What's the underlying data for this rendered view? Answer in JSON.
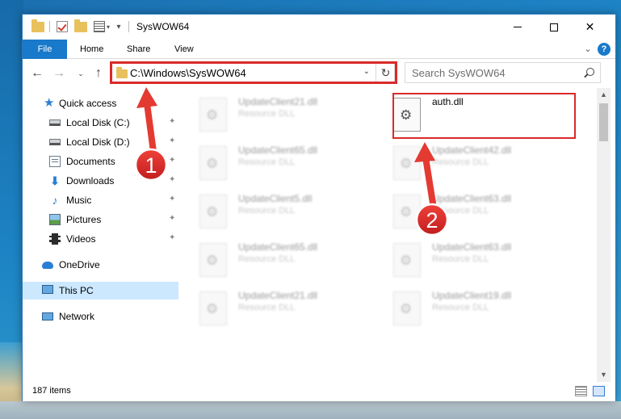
{
  "window": {
    "title": "SysWOW64",
    "controls": {
      "minimize": "—",
      "maximize": "☐",
      "close": "✕"
    }
  },
  "ribbon": {
    "tabs": [
      {
        "label": "File"
      },
      {
        "label": "Home"
      },
      {
        "label": "Share"
      },
      {
        "label": "View"
      }
    ],
    "help": "?"
  },
  "nav": {
    "back": "←",
    "forward": "→",
    "recent": "⌄",
    "up": "↑",
    "address": "C:\\Windows\\SysWOW64",
    "address_dropdown": "⌄",
    "refresh": "↻",
    "search_placeholder": "Search SysWOW64"
  },
  "sidebar": {
    "items": [
      {
        "label": "Quick access",
        "icon": "star-icon"
      },
      {
        "label": "Local Disk (C:)",
        "icon": "drive-icon",
        "pinned": true
      },
      {
        "label": "Local Disk (D:)",
        "icon": "drive-icon",
        "pinned": true
      },
      {
        "label": "Documents",
        "icon": "documents-icon",
        "pinned": true
      },
      {
        "label": "Downloads",
        "icon": "download-icon",
        "pinned": true
      },
      {
        "label": "Music",
        "icon": "music-icon",
        "pinned": true
      },
      {
        "label": "Pictures",
        "icon": "pictures-icon",
        "pinned": true
      },
      {
        "label": "Videos",
        "icon": "videos-icon",
        "pinned": true
      },
      {
        "label": "OneDrive",
        "icon": "onedrive-icon"
      },
      {
        "label": "This PC",
        "icon": "computer-icon",
        "selected": true
      },
      {
        "label": "Network",
        "icon": "network-icon"
      }
    ],
    "pin_glyph": "📌"
  },
  "files": {
    "left_column": [
      {
        "name": "UpdateClient21.dll",
        "type": "Resource DLL"
      },
      {
        "name": "UpdateClient65.dll",
        "type": "Resource DLL"
      },
      {
        "name": "UpdateClient5.dll",
        "type": "Resource DLL"
      },
      {
        "name": "UpdateClient65.dll",
        "type": "Resource DLL"
      },
      {
        "name": "UpdateClient21.dll",
        "type": "Resource DLL"
      }
    ],
    "right_column": [
      {
        "name": "auth.dll",
        "type": ""
      },
      {
        "name": "UpdateClient42.dll",
        "type": "Resource DLL"
      },
      {
        "name": "UpdateClient63.dll",
        "type": "Resource DLL"
      },
      {
        "name": "UpdateClient63.dll",
        "type": "Resource DLL"
      },
      {
        "name": "UpdateClient19.dll",
        "type": "Resource DLL"
      }
    ]
  },
  "status": {
    "item_count": "187 items"
  },
  "annotations": [
    {
      "number": "1"
    },
    {
      "number": "2"
    }
  ],
  "colors": {
    "accent": "#1979ca",
    "highlight_red": "#d92a2a",
    "selected_nav": "#cce8ff"
  }
}
